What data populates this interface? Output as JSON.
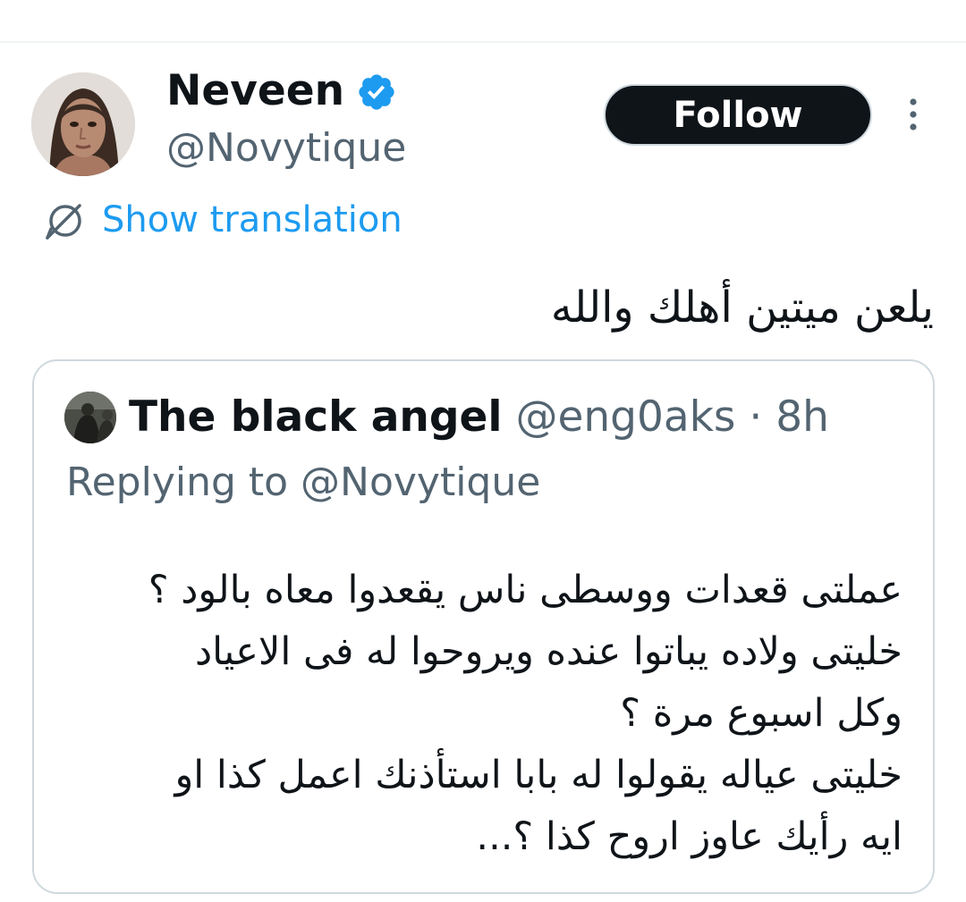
{
  "tweet": {
    "author": {
      "display_name": "Neveen",
      "handle": "@Novytique",
      "verified": true
    },
    "follow_label": "Follow",
    "translate_label": "Show translation",
    "text": "يلعن ميتين أهلك والله"
  },
  "quoted_tweet": {
    "author_name": "The black angel",
    "handle": "@eng0aks",
    "separator": "·",
    "time": "8h",
    "replying_to": "Replying to @Novytique",
    "lines": [
      "عملتى قعدات ووسطى ناس يقعدوا معاه بالود ؟",
      "خليتى ولاده يباتوا عنده ويروحوا له فى الاعياد",
      "وكل اسبوع مرة ؟",
      "خليتى عياله يقولوا له بابا استأذنك اعمل كذا او",
      "ايه رأيك عاوز اروح كذا ؟..."
    ]
  },
  "colors": {
    "text_primary": "#0f1419",
    "text_secondary": "#536471",
    "link": "#1d9bf0",
    "verified_badge": "#1d9bf0",
    "follow_button_bg": "#0f1419",
    "border": "#cfd9de"
  },
  "icons": {
    "verified": "verified-badge-icon",
    "more": "more-vertical-icon",
    "translate": "translate-globe-icon"
  }
}
